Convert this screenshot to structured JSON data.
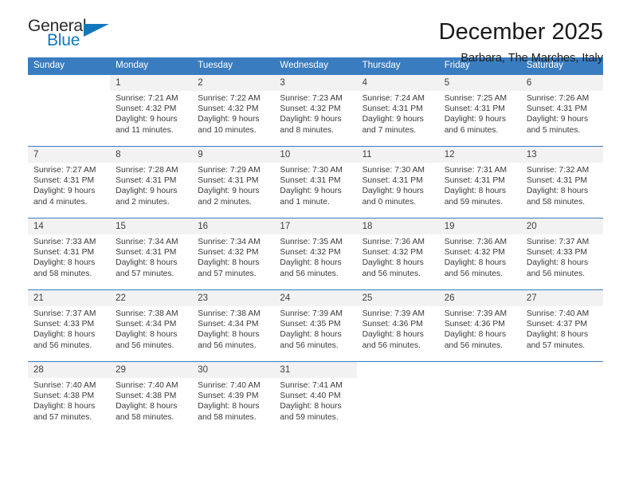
{
  "brand": {
    "line1": "General",
    "line2": "Blue",
    "triangle_icon": "triangle-icon",
    "accent_color": "#1278be"
  },
  "header": {
    "title": "December 2025",
    "subtitle": "Barbara, The Marches, Italy"
  },
  "theme": {
    "header_row_bg": "#3a7cc0",
    "daynum_bg": "#f2f2f2",
    "grid_line": "#3a7cc0",
    "text": "#3a3a3a"
  },
  "weekdays": [
    "Sunday",
    "Monday",
    "Tuesday",
    "Wednesday",
    "Thursday",
    "Friday",
    "Saturday"
  ],
  "weeks": [
    [
      {
        "day": "",
        "detail": ""
      },
      {
        "day": "1",
        "detail": "Sunrise: 7:21 AM\nSunset: 4:32 PM\nDaylight: 9 hours\nand 11 minutes."
      },
      {
        "day": "2",
        "detail": "Sunrise: 7:22 AM\nSunset: 4:32 PM\nDaylight: 9 hours\nand 10 minutes."
      },
      {
        "day": "3",
        "detail": "Sunrise: 7:23 AM\nSunset: 4:32 PM\nDaylight: 9 hours\nand 8 minutes."
      },
      {
        "day": "4",
        "detail": "Sunrise: 7:24 AM\nSunset: 4:31 PM\nDaylight: 9 hours\nand 7 minutes."
      },
      {
        "day": "5",
        "detail": "Sunrise: 7:25 AM\nSunset: 4:31 PM\nDaylight: 9 hours\nand 6 minutes."
      },
      {
        "day": "6",
        "detail": "Sunrise: 7:26 AM\nSunset: 4:31 PM\nDaylight: 9 hours\nand 5 minutes."
      }
    ],
    [
      {
        "day": "7",
        "detail": "Sunrise: 7:27 AM\nSunset: 4:31 PM\nDaylight: 9 hours\nand 4 minutes."
      },
      {
        "day": "8",
        "detail": "Sunrise: 7:28 AM\nSunset: 4:31 PM\nDaylight: 9 hours\nand 2 minutes."
      },
      {
        "day": "9",
        "detail": "Sunrise: 7:29 AM\nSunset: 4:31 PM\nDaylight: 9 hours\nand 2 minutes."
      },
      {
        "day": "10",
        "detail": "Sunrise: 7:30 AM\nSunset: 4:31 PM\nDaylight: 9 hours\nand 1 minute."
      },
      {
        "day": "11",
        "detail": "Sunrise: 7:30 AM\nSunset: 4:31 PM\nDaylight: 9 hours\nand 0 minutes."
      },
      {
        "day": "12",
        "detail": "Sunrise: 7:31 AM\nSunset: 4:31 PM\nDaylight: 8 hours\nand 59 minutes."
      },
      {
        "day": "13",
        "detail": "Sunrise: 7:32 AM\nSunset: 4:31 PM\nDaylight: 8 hours\nand 58 minutes."
      }
    ],
    [
      {
        "day": "14",
        "detail": "Sunrise: 7:33 AM\nSunset: 4:31 PM\nDaylight: 8 hours\nand 58 minutes."
      },
      {
        "day": "15",
        "detail": "Sunrise: 7:34 AM\nSunset: 4:31 PM\nDaylight: 8 hours\nand 57 minutes."
      },
      {
        "day": "16",
        "detail": "Sunrise: 7:34 AM\nSunset: 4:32 PM\nDaylight: 8 hours\nand 57 minutes."
      },
      {
        "day": "17",
        "detail": "Sunrise: 7:35 AM\nSunset: 4:32 PM\nDaylight: 8 hours\nand 56 minutes."
      },
      {
        "day": "18",
        "detail": "Sunrise: 7:36 AM\nSunset: 4:32 PM\nDaylight: 8 hours\nand 56 minutes."
      },
      {
        "day": "19",
        "detail": "Sunrise: 7:36 AM\nSunset: 4:32 PM\nDaylight: 8 hours\nand 56 minutes."
      },
      {
        "day": "20",
        "detail": "Sunrise: 7:37 AM\nSunset: 4:33 PM\nDaylight: 8 hours\nand 56 minutes."
      }
    ],
    [
      {
        "day": "21",
        "detail": "Sunrise: 7:37 AM\nSunset: 4:33 PM\nDaylight: 8 hours\nand 56 minutes."
      },
      {
        "day": "22",
        "detail": "Sunrise: 7:38 AM\nSunset: 4:34 PM\nDaylight: 8 hours\nand 56 minutes."
      },
      {
        "day": "23",
        "detail": "Sunrise: 7:38 AM\nSunset: 4:34 PM\nDaylight: 8 hours\nand 56 minutes."
      },
      {
        "day": "24",
        "detail": "Sunrise: 7:39 AM\nSunset: 4:35 PM\nDaylight: 8 hours\nand 56 minutes."
      },
      {
        "day": "25",
        "detail": "Sunrise: 7:39 AM\nSunset: 4:36 PM\nDaylight: 8 hours\nand 56 minutes."
      },
      {
        "day": "26",
        "detail": "Sunrise: 7:39 AM\nSunset: 4:36 PM\nDaylight: 8 hours\nand 56 minutes."
      },
      {
        "day": "27",
        "detail": "Sunrise: 7:40 AM\nSunset: 4:37 PM\nDaylight: 8 hours\nand 57 minutes."
      }
    ],
    [
      {
        "day": "28",
        "detail": "Sunrise: 7:40 AM\nSunset: 4:38 PM\nDaylight: 8 hours\nand 57 minutes."
      },
      {
        "day": "29",
        "detail": "Sunrise: 7:40 AM\nSunset: 4:38 PM\nDaylight: 8 hours\nand 58 minutes."
      },
      {
        "day": "30",
        "detail": "Sunrise: 7:40 AM\nSunset: 4:39 PM\nDaylight: 8 hours\nand 58 minutes."
      },
      {
        "day": "31",
        "detail": "Sunrise: 7:41 AM\nSunset: 4:40 PM\nDaylight: 8 hours\nand 59 minutes."
      },
      {
        "day": "",
        "detail": ""
      },
      {
        "day": "",
        "detail": ""
      },
      {
        "day": "",
        "detail": ""
      }
    ]
  ]
}
